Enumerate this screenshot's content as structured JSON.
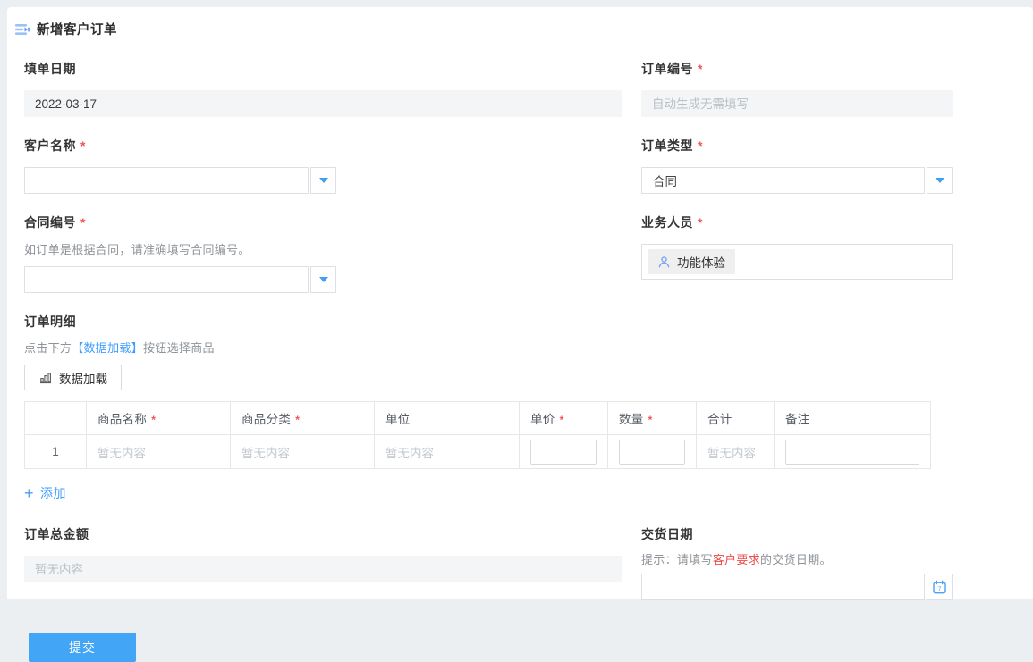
{
  "header": {
    "title": "新增客户订单"
  },
  "form": {
    "fill_date": {
      "label": "填单日期",
      "star": "",
      "value": "2022-03-17"
    },
    "order_no": {
      "label": "订单编号",
      "star": "*",
      "placeholder": "自动生成无需填写"
    },
    "customer": {
      "label": "客户名称",
      "star": "*"
    },
    "order_type": {
      "label": "订单类型",
      "star": "*",
      "value": "合同"
    },
    "contract_no": {
      "label": "合同编号",
      "star": "*",
      "hint": "如订单是根据合同，请准确填写合同编号。"
    },
    "salesperson": {
      "label": "业务人员",
      "star": "*",
      "tag": "功能体验"
    },
    "order_total": {
      "label": "订单总金额",
      "star": "",
      "placeholder": "暂无内容"
    },
    "delivery_date": {
      "label": "交货日期",
      "star": "",
      "hint_prefix": "提示：请填写",
      "hint_em": "客户要求",
      "hint_suffix": "的交货日期。"
    }
  },
  "detail": {
    "section_label": "订单明细",
    "hint_prefix": "点击下方",
    "hint_button": "【数据加载】",
    "hint_suffix": "按钮选择商品",
    "load_button_label": "数据加载",
    "add_label": "添加",
    "table": {
      "columns": [
        {
          "label": "",
          "star": ""
        },
        {
          "label": "商品名称",
          "star": "*"
        },
        {
          "label": "商品分类",
          "star": "*"
        },
        {
          "label": "单位",
          "star": ""
        },
        {
          "label": "单价",
          "star": "*"
        },
        {
          "label": "数量",
          "star": "*"
        },
        {
          "label": "合计",
          "star": ""
        },
        {
          "label": "备注",
          "star": ""
        }
      ],
      "rows": [
        {
          "index": "1",
          "product_name": "暂无内容",
          "category": "暂无内容",
          "unit": "暂无内容",
          "unit_price": "",
          "quantity": "",
          "total": "暂无内容",
          "remark": ""
        }
      ]
    }
  },
  "footer": {
    "submit_label": "提交"
  },
  "colors": {
    "accent": "#409eff",
    "required_star": "#f25555",
    "hint_red": "#ef4c4c",
    "submit_bg": "#42a5f5"
  }
}
